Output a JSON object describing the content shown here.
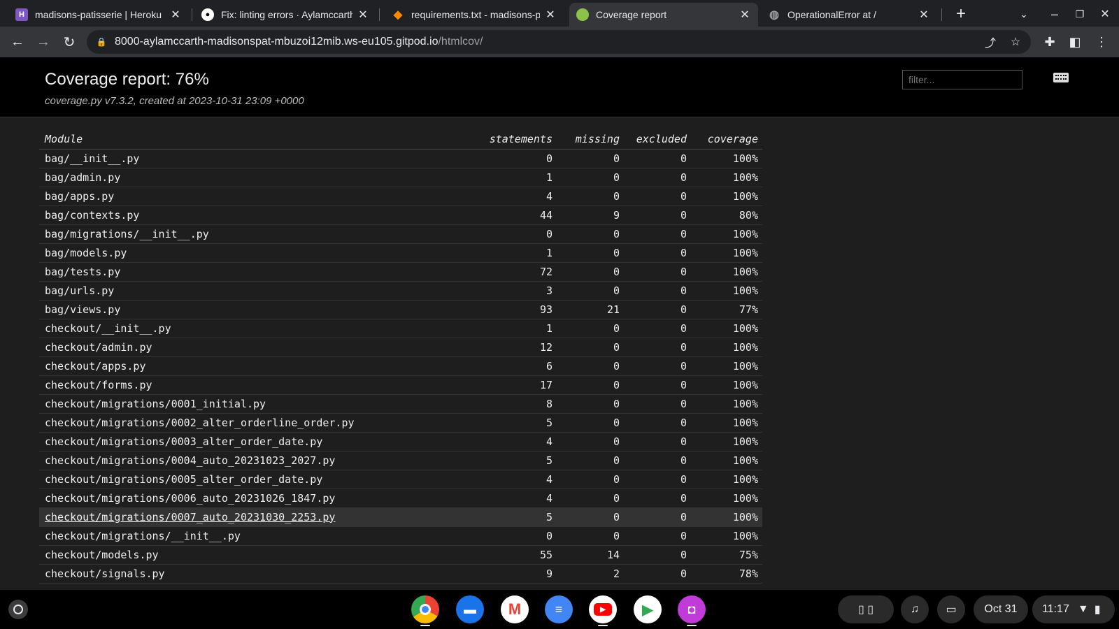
{
  "tabs": [
    {
      "title": "madisons-patisserie | Heroku",
      "favicon": "heroku-icon",
      "color": "#7e57c2",
      "active": false
    },
    {
      "title": "Fix: linting errors · Aylamccarthy",
      "favicon": "github-icon",
      "color": "#ffffff",
      "active": false
    },
    {
      "title": "requirements.txt - madisons-patisserie",
      "favicon": "gitpod-icon",
      "color": "#ff8a00",
      "active": false
    },
    {
      "title": "Coverage report",
      "favicon": "coverage-icon",
      "color": "#8bc34a",
      "active": true
    },
    {
      "title": "OperationalError at /",
      "favicon": "globe-icon",
      "color": "#9aa0a6",
      "active": false
    }
  ],
  "address": {
    "host": "8000-aylamccarth-madisonspat-mbuzoi12mib.ws-eu105.gitpod.io",
    "path": "/htmlcov/"
  },
  "report": {
    "title": "Coverage report: 76%",
    "subtitle": "coverage.py v7.3.2, created at 2023-10-31 23:09 +0000",
    "filter_placeholder": "filter..."
  },
  "table": {
    "headers": {
      "module": "Module",
      "statements": "statements",
      "missing": "missing",
      "excluded": "excluded",
      "coverage": "coverage"
    },
    "rows": [
      {
        "module": "bag/__init__.py",
        "statements": "0",
        "missing": "0",
        "excluded": "0",
        "coverage": "100%"
      },
      {
        "module": "bag/admin.py",
        "statements": "1",
        "missing": "0",
        "excluded": "0",
        "coverage": "100%"
      },
      {
        "module": "bag/apps.py",
        "statements": "4",
        "missing": "0",
        "excluded": "0",
        "coverage": "100%"
      },
      {
        "module": "bag/contexts.py",
        "statements": "44",
        "missing": "9",
        "excluded": "0",
        "coverage": "80%"
      },
      {
        "module": "bag/migrations/__init__.py",
        "statements": "0",
        "missing": "0",
        "excluded": "0",
        "coverage": "100%"
      },
      {
        "module": "bag/models.py",
        "statements": "1",
        "missing": "0",
        "excluded": "0",
        "coverage": "100%"
      },
      {
        "module": "bag/tests.py",
        "statements": "72",
        "missing": "0",
        "excluded": "0",
        "coverage": "100%"
      },
      {
        "module": "bag/urls.py",
        "statements": "3",
        "missing": "0",
        "excluded": "0",
        "coverage": "100%"
      },
      {
        "module": "bag/views.py",
        "statements": "93",
        "missing": "21",
        "excluded": "0",
        "coverage": "77%"
      },
      {
        "module": "checkout/__init__.py",
        "statements": "1",
        "missing": "0",
        "excluded": "0",
        "coverage": "100%"
      },
      {
        "module": "checkout/admin.py",
        "statements": "12",
        "missing": "0",
        "excluded": "0",
        "coverage": "100%"
      },
      {
        "module": "checkout/apps.py",
        "statements": "6",
        "missing": "0",
        "excluded": "0",
        "coverage": "100%"
      },
      {
        "module": "checkout/forms.py",
        "statements": "17",
        "missing": "0",
        "excluded": "0",
        "coverage": "100%"
      },
      {
        "module": "checkout/migrations/0001_initial.py",
        "statements": "8",
        "missing": "0",
        "excluded": "0",
        "coverage": "100%"
      },
      {
        "module": "checkout/migrations/0002_alter_orderline_order.py",
        "statements": "5",
        "missing": "0",
        "excluded": "0",
        "coverage": "100%"
      },
      {
        "module": "checkout/migrations/0003_alter_order_date.py",
        "statements": "4",
        "missing": "0",
        "excluded": "0",
        "coverage": "100%"
      },
      {
        "module": "checkout/migrations/0004_auto_20231023_2027.py",
        "statements": "5",
        "missing": "0",
        "excluded": "0",
        "coverage": "100%"
      },
      {
        "module": "checkout/migrations/0005_alter_order_date.py",
        "statements": "4",
        "missing": "0",
        "excluded": "0",
        "coverage": "100%"
      },
      {
        "module": "checkout/migrations/0006_auto_20231026_1847.py",
        "statements": "4",
        "missing": "0",
        "excluded": "0",
        "coverage": "100%"
      },
      {
        "module": "checkout/migrations/0007_auto_20231030_2253.py",
        "statements": "5",
        "missing": "0",
        "excluded": "0",
        "coverage": "100%",
        "hovered": true
      },
      {
        "module": "checkout/migrations/__init__.py",
        "statements": "0",
        "missing": "0",
        "excluded": "0",
        "coverage": "100%"
      },
      {
        "module": "checkout/models.py",
        "statements": "55",
        "missing": "14",
        "excluded": "0",
        "coverage": "75%"
      },
      {
        "module": "checkout/signals.py",
        "statements": "9",
        "missing": "2",
        "excluded": "0",
        "coverage": "78%"
      }
    ]
  },
  "shelf": {
    "apps": [
      {
        "name": "chrome-icon",
        "color": "#4285f4",
        "running": true
      },
      {
        "name": "files-icon",
        "color": "#1a73e8",
        "running": false
      },
      {
        "name": "gmail-icon",
        "color": "#ffffff",
        "running": false
      },
      {
        "name": "docs-icon",
        "color": "#4285f4",
        "running": false
      },
      {
        "name": "youtube-icon",
        "color": "#ff0000",
        "running": true
      },
      {
        "name": "play-store-icon",
        "color": "#ffffff",
        "running": false
      },
      {
        "name": "app-icon",
        "color": "#c03bd8",
        "running": true
      }
    ],
    "date": "Oct 31",
    "time": "11:17"
  }
}
